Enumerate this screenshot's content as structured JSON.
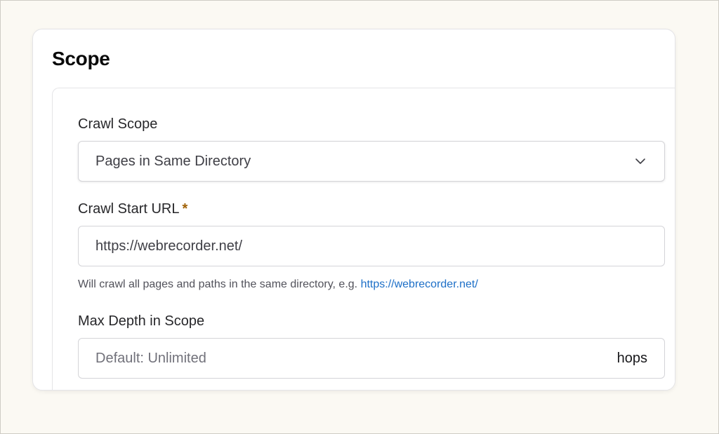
{
  "card": {
    "title": "Scope"
  },
  "crawl_scope": {
    "label": "Crawl Scope",
    "selected": "Pages in Same Directory"
  },
  "start_url": {
    "label": "Crawl Start URL",
    "required_mark": "*",
    "value": "https://webrecorder.net/",
    "help_text": "Will crawl all pages and paths in the same directory, e.g.",
    "help_link": "https://webrecorder.net/"
  },
  "max_depth": {
    "label": "Max Depth in Scope",
    "placeholder": "Default: Unlimited",
    "suffix": "hops"
  },
  "colors": {
    "accent_link": "#1d6fc7",
    "required": "#a16207",
    "background": "#fbf9f3"
  }
}
